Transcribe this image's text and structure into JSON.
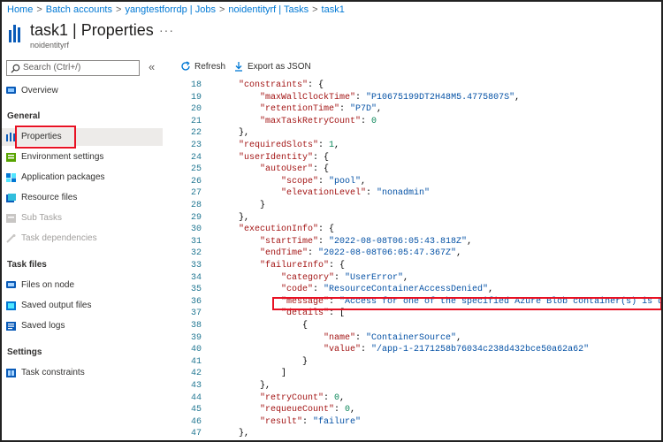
{
  "breadcrumb": [
    "Home",
    "Batch accounts",
    "yangtestforrdp | Jobs",
    "noidentityrf | Tasks",
    "task1"
  ],
  "header": {
    "title": "task1 | Properties",
    "subtitle": "noidentityrf",
    "more": "···"
  },
  "search": {
    "placeholder": "Search (Ctrl+/)"
  },
  "collapse_glyph": "«",
  "sidebar": {
    "overview": {
      "label": "Overview",
      "icon": "overview-icon"
    },
    "general_heading": "General",
    "general": [
      {
        "label": "Properties",
        "icon": "properties-icon",
        "selected": true
      },
      {
        "label": "Environment settings",
        "icon": "environment-icon"
      },
      {
        "label": "Application packages",
        "icon": "packages-icon"
      },
      {
        "label": "Resource files",
        "icon": "resource-files-icon"
      },
      {
        "label": "Sub Tasks",
        "icon": "subtasks-icon",
        "disabled": true
      },
      {
        "label": "Task dependencies",
        "icon": "dependencies-icon",
        "disabled": true
      }
    ],
    "task_files_heading": "Task files",
    "task_files": [
      {
        "label": "Files on node",
        "icon": "files-node-icon"
      },
      {
        "label": "Saved output files",
        "icon": "output-files-icon"
      },
      {
        "label": "Saved logs",
        "icon": "logs-icon"
      }
    ],
    "settings_heading": "Settings",
    "settings": [
      {
        "label": "Task constraints",
        "icon": "constraints-icon"
      }
    ]
  },
  "toolbar": {
    "refresh": "Refresh",
    "export": "Export as JSON"
  },
  "colors": {
    "accent": "#0078d4",
    "highlight": "#e81123",
    "json_key": "#a31515",
    "json_string": "#0451a5",
    "json_number": "#098658"
  },
  "code_lines": [
    {
      "n": "18",
      "i": 1,
      "t": [
        [
          "k",
          "\"constraints\""
        ],
        [
          "p",
          ": {"
        ]
      ]
    },
    {
      "n": "19",
      "i": 2,
      "t": [
        [
          "k",
          "\"maxWallClockTime\""
        ],
        [
          "p",
          ": "
        ],
        [
          "s",
          "\"P10675199DT2H48M5.4775807S\""
        ],
        [
          "p",
          ","
        ]
      ]
    },
    {
      "n": "20",
      "i": 2,
      "t": [
        [
          "k",
          "\"retentionTime\""
        ],
        [
          "p",
          ": "
        ],
        [
          "s",
          "\"P7D\""
        ],
        [
          "p",
          ","
        ]
      ]
    },
    {
      "n": "21",
      "i": 2,
      "t": [
        [
          "k",
          "\"maxTaskRetryCount\""
        ],
        [
          "p",
          ": "
        ],
        [
          "n",
          "0"
        ]
      ]
    },
    {
      "n": "22",
      "i": 1,
      "t": [
        [
          "p",
          "},"
        ]
      ]
    },
    {
      "n": "23",
      "i": 1,
      "t": [
        [
          "k",
          "\"requiredSlots\""
        ],
        [
          "p",
          ": "
        ],
        [
          "n",
          "1"
        ],
        [
          "p",
          ","
        ]
      ]
    },
    {
      "n": "24",
      "i": 1,
      "t": [
        [
          "k",
          "\"userIdentity\""
        ],
        [
          "p",
          ": {"
        ]
      ]
    },
    {
      "n": "25",
      "i": 2,
      "t": [
        [
          "k",
          "\"autoUser\""
        ],
        [
          "p",
          ": {"
        ]
      ]
    },
    {
      "n": "26",
      "i": 3,
      "t": [
        [
          "k",
          "\"scope\""
        ],
        [
          "p",
          ": "
        ],
        [
          "s",
          "\"pool\""
        ],
        [
          "p",
          ","
        ]
      ]
    },
    {
      "n": "27",
      "i": 3,
      "t": [
        [
          "k",
          "\"elevationLevel\""
        ],
        [
          "p",
          ": "
        ],
        [
          "s",
          "\"nonadmin\""
        ]
      ]
    },
    {
      "n": "28",
      "i": 2,
      "t": [
        [
          "p",
          "}"
        ]
      ]
    },
    {
      "n": "29",
      "i": 1,
      "t": [
        [
          "p",
          "},"
        ]
      ]
    },
    {
      "n": "30",
      "i": 1,
      "t": [
        [
          "k",
          "\"executionInfo\""
        ],
        [
          "p",
          ": {"
        ]
      ]
    },
    {
      "n": "31",
      "i": 2,
      "t": [
        [
          "k",
          "\"startTime\""
        ],
        [
          "p",
          ": "
        ],
        [
          "s",
          "\"2022-08-08T06:05:43.818Z\""
        ],
        [
          "p",
          ","
        ]
      ]
    },
    {
      "n": "32",
      "i": 2,
      "t": [
        [
          "k",
          "\"endTime\""
        ],
        [
          "p",
          ": "
        ],
        [
          "s",
          "\"2022-08-08T06:05:47.367Z\""
        ],
        [
          "p",
          ","
        ]
      ]
    },
    {
      "n": "33",
      "i": 2,
      "t": [
        [
          "k",
          "\"failureInfo\""
        ],
        [
          "p",
          ": {"
        ]
      ]
    },
    {
      "n": "34",
      "i": 3,
      "t": [
        [
          "k",
          "\"category\""
        ],
        [
          "p",
          ": "
        ],
        [
          "s",
          "\"UserError\""
        ],
        [
          "p",
          ","
        ]
      ]
    },
    {
      "n": "35",
      "i": 3,
      "t": [
        [
          "k",
          "\"code\""
        ],
        [
          "p",
          ": "
        ],
        [
          "s",
          "\"ResourceContainerAccessDenied\""
        ],
        [
          "p",
          ","
        ]
      ]
    },
    {
      "n": "36",
      "i": 3,
      "t": [
        [
          "k",
          "\"message\""
        ],
        [
          "p",
          ": "
        ],
        [
          "s",
          "\"Access for one of the specified Azure Blob container(s) is denied\""
        ]
      ]
    },
    {
      "n": "37",
      "i": 3,
      "t": [
        [
          "k",
          "\"details\""
        ],
        [
          "p",
          ": ["
        ]
      ]
    },
    {
      "n": "38",
      "i": 4,
      "t": [
        [
          "p",
          "{"
        ]
      ]
    },
    {
      "n": "39",
      "i": 5,
      "t": [
        [
          "k",
          "\"name\""
        ],
        [
          "p",
          ": "
        ],
        [
          "s",
          "\"ContainerSource\""
        ],
        [
          "p",
          ","
        ]
      ]
    },
    {
      "n": "40",
      "i": 5,
      "t": [
        [
          "k",
          "\"value\""
        ],
        [
          "p",
          ": "
        ],
        [
          "s",
          "\"/app-1-2171258b76034c238d432bce50a62a62\""
        ]
      ]
    },
    {
      "n": "41",
      "i": 4,
      "t": [
        [
          "p",
          "}"
        ]
      ]
    },
    {
      "n": "42",
      "i": 3,
      "t": [
        [
          "p",
          "]"
        ]
      ]
    },
    {
      "n": "43",
      "i": 2,
      "t": [
        [
          "p",
          "},"
        ]
      ]
    },
    {
      "n": "44",
      "i": 2,
      "t": [
        [
          "k",
          "\"retryCount\""
        ],
        [
          "p",
          ": "
        ],
        [
          "n",
          "0"
        ],
        [
          "p",
          ","
        ]
      ]
    },
    {
      "n": "45",
      "i": 2,
      "t": [
        [
          "k",
          "\"requeueCount\""
        ],
        [
          "p",
          ": "
        ],
        [
          "n",
          "0"
        ],
        [
          "p",
          ","
        ]
      ]
    },
    {
      "n": "46",
      "i": 2,
      "t": [
        [
          "k",
          "\"result\""
        ],
        [
          "p",
          ": "
        ],
        [
          "s",
          "\"failure\""
        ]
      ]
    },
    {
      "n": "47",
      "i": 1,
      "t": [
        [
          "p",
          "},"
        ]
      ]
    }
  ]
}
